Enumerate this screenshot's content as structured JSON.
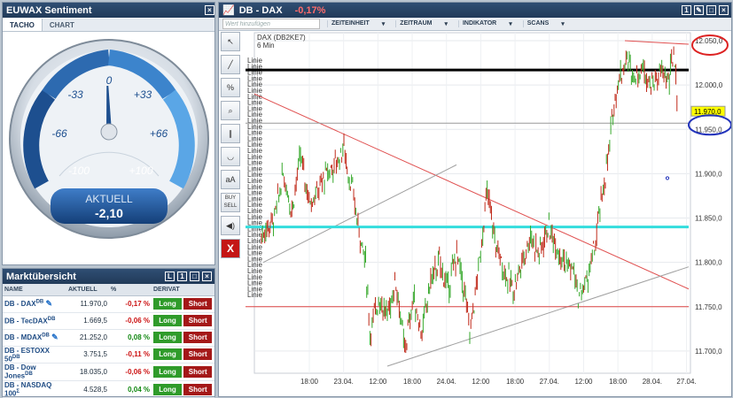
{
  "euwax": {
    "title": "EUWAX Sentiment",
    "tabs": [
      "TACHO",
      "CHART"
    ],
    "gauge": {
      "ticks": [
        "-33",
        "0",
        "+33",
        "-66",
        "+66",
        "-100",
        "+100"
      ],
      "label": "AKTUELL",
      "value": "-2,10",
      "value_num": -2.1
    }
  },
  "market": {
    "title": "Marktübersicht",
    "columns": [
      "NAME",
      "AKTUELL",
      "%",
      "DERIVAT"
    ],
    "rows": [
      {
        "name": "DB - DAX",
        "sup": "DB",
        "value": "11.970,0",
        "chg": "-0,17 %",
        "neg": true,
        "pencil": true
      },
      {
        "name": "DB - TecDAX",
        "sup": "DB",
        "value": "1.669,5",
        "chg": "-0,06 %",
        "neg": true,
        "pencil": false
      },
      {
        "name": "DB - MDAX",
        "sup": "DB",
        "value": "21.252,0",
        "chg": "0,08 %",
        "neg": false,
        "pencil": true
      },
      {
        "name": "DB - ESTOXX 50",
        "sup": "DB",
        "value": "3.751,5",
        "chg": "-0,11 %",
        "neg": true,
        "pencil": false
      },
      {
        "name": "DB - Dow Jones",
        "sup": "DB",
        "value": "18.035,0",
        "chg": "-0,06 %",
        "neg": true,
        "pencil": false
      },
      {
        "name": "DB - NASDAQ 100",
        "sup": "Σ",
        "value": "4.528,5",
        "chg": "0,04 %",
        "neg": false,
        "pencil": false
      }
    ],
    "long_label": "Long",
    "short_label": "Short"
  },
  "chart_panel": {
    "title": "DB - DAX",
    "change": "-0,17%",
    "search_placeholder": "Wert hinzufügen",
    "menus": [
      "ZEITEINHEIT",
      "ZEITRAUM",
      "INDIKATOR",
      "SCANS"
    ],
    "tools": [
      "cursor-icon",
      "line-icon",
      "percent-icon",
      "zoom-icon",
      "parallel-icon",
      "curve-icon",
      "text-icon",
      "buy-sell-icon",
      "speaker-icon",
      "delete-icon"
    ],
    "tool_labels": [
      "↖",
      "╱",
      "%",
      "⌕",
      "∥",
      "◡",
      "aA",
      "BUY SELL",
      "◀)",
      "X"
    ]
  },
  "chart_data": {
    "type": "candlestick",
    "instrument": "DAX (DB2KE7)",
    "interval": "6 Min",
    "x_ticks": [
      "18:00",
      "23.04.",
      "12:00",
      "18:00",
      "24.04.",
      "12:00",
      "18:00",
      "27.04.",
      "12:00",
      "18:00",
      "28.04.",
      "27.04."
    ],
    "y_ticks": [
      12050,
      12000,
      11950,
      11900,
      11850,
      11800,
      11750,
      11700
    ],
    "y_tick_labels": [
      "12.050,0",
      "12.000,0",
      "11.950,0",
      "11.900,0",
      "11.850,0",
      "11.800,0",
      "11.750,0",
      "11.700,0"
    ],
    "ylim": [
      11675,
      12055
    ],
    "last_price": "11.970,0",
    "last_value": 11970,
    "line_labels": [
      "Linie",
      "Linie",
      "Linie",
      "Linie",
      "Linie",
      "Linie",
      "Linie",
      "Linie",
      "Linie",
      "Linie",
      "Linie",
      "Linie",
      "Linie",
      "Linie",
      "Linie",
      "Linie",
      "Linie",
      "Linie",
      "Linie",
      "Linie",
      "Linie",
      "Linie",
      "Linie",
      "Linie",
      "Linie",
      "Linie",
      "Linie",
      "Linie",
      "Linie",
      "Linie",
      "Linie",
      "Linie",
      "Linie",
      "Linie",
      "Linie",
      "Linie",
      "Linie",
      "Linie",
      "Linie",
      "Linie"
    ],
    "hlines": [
      {
        "value": 12017,
        "color": "#000000",
        "width": 3
      },
      {
        "value": 11957,
        "color": "#999999",
        "width": 1
      },
      {
        "value": 11840,
        "color": "#33dddd",
        "width": 3
      },
      {
        "value": 11750,
        "color": "#dd4444",
        "width": 1
      }
    ],
    "close_path": [
      [
        0,
        11830
      ],
      [
        3,
        11850
      ],
      [
        5,
        11900
      ],
      [
        7,
        11860
      ],
      [
        9,
        11920
      ],
      [
        11,
        11870
      ],
      [
        13,
        11880
      ],
      [
        15,
        11900
      ],
      [
        17,
        11910
      ],
      [
        19,
        11930
      ],
      [
        20,
        11900
      ],
      [
        21,
        11880
      ],
      [
        22,
        11850
      ],
      [
        24,
        11800
      ],
      [
        25,
        11720
      ],
      [
        27,
        11760
      ],
      [
        29,
        11740
      ],
      [
        31,
        11780
      ],
      [
        33,
        11700
      ],
      [
        35,
        11760
      ],
      [
        37,
        11720
      ],
      [
        39,
        11780
      ],
      [
        41,
        11800
      ],
      [
        43,
        11770
      ],
      [
        45,
        11810
      ],
      [
        47,
        11760
      ],
      [
        48,
        11720
      ],
      [
        50,
        11790
      ],
      [
        52,
        11880
      ],
      [
        54,
        11820
      ],
      [
        56,
        11790
      ],
      [
        58,
        11770
      ],
      [
        60,
        11800
      ],
      [
        62,
        11830
      ],
      [
        64,
        11810
      ],
      [
        66,
        11840
      ],
      [
        68,
        11820
      ],
      [
        70,
        11800
      ],
      [
        72,
        11790
      ],
      [
        73,
        11760
      ],
      [
        75,
        11780
      ],
      [
        77,
        11820
      ],
      [
        78,
        11860
      ],
      [
        80,
        11920
      ],
      [
        81,
        11970
      ],
      [
        82,
        12000
      ],
      [
        84,
        12030
      ],
      [
        86,
        12010
      ],
      [
        88,
        12020
      ],
      [
        90,
        12000
      ],
      [
        92,
        12015
      ],
      [
        94,
        12005
      ],
      [
        95,
        12040
      ],
      [
        96,
        11970
      ]
    ]
  }
}
